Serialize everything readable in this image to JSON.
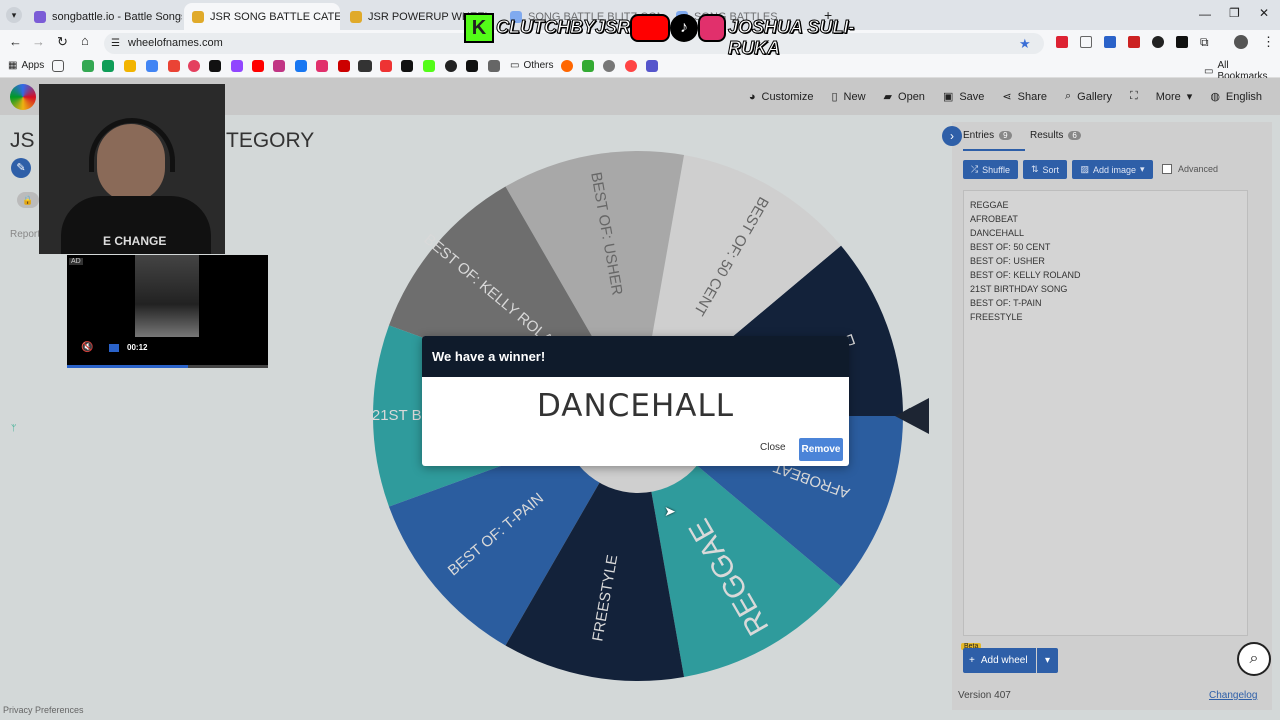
{
  "browser": {
    "tabs": [
      {
        "title": "songbattle.io - Battle Songs ag",
        "color": "#7b5cd6"
      },
      {
        "title": "JSR SONG BATTLE CATEGO",
        "color": "#e0aa2a"
      },
      {
        "title": "JSR POWERUP WHEEL",
        "color": "#e0aa2a"
      },
      {
        "title": "SONG BATTLE BLITZ COMP - E",
        "color": "#4285f4"
      },
      {
        "title": "SONG BATTLES",
        "color": "#4285f4"
      }
    ],
    "url": "wheelofnames.com",
    "bookmarks": {
      "apps": "Apps",
      "others": "Others",
      "all": "All Bookmarks"
    }
  },
  "overlay": {
    "brand_left": "CLUTCHBYJSR",
    "brand_right": "JOSHUA SULI-RUKA",
    "ad_badge": "AD",
    "ad_time": "00:12",
    "cam_text": "E CHANGE"
  },
  "nav": {
    "customize": "Customize",
    "new": "New",
    "open": "Open",
    "save": "Save",
    "share": "Share",
    "gallery": "Gallery",
    "more": "More",
    "language": "English"
  },
  "page": {
    "title_left": "JS",
    "title_right": "TEGORY",
    "report": "Report",
    "privacy": "Privacy Preferences"
  },
  "wheel": {
    "segments": [
      {
        "label": "REGGAE",
        "color": "#2f9b9c"
      },
      {
        "label": "AFROBEAT",
        "color": "#2b5d9f"
      },
      {
        "label": "DANCEHALL",
        "color": "#13223a"
      },
      {
        "label": "BEST OF: 50 CENT",
        "color": "#cfcfcf"
      },
      {
        "label": "BEST OF: USHER",
        "color": "#a8a8a8"
      },
      {
        "label": "BEST OF: KELLY ROLAND",
        "color": "#6e6e6e"
      },
      {
        "label": "21ST BIRTHDAY SONG",
        "color": "#2f9b9c"
      },
      {
        "label": "BEST OF: T-PAIN",
        "color": "#2b5d9f"
      },
      {
        "label": "FREESTYLE",
        "color": "#13223a"
      }
    ]
  },
  "modal": {
    "heading": "We have a winner!",
    "winner": "DANCEHALL",
    "close": "Close",
    "remove": "Remove"
  },
  "panel": {
    "entries_tab": "Entries",
    "entries_count": "9",
    "results_tab": "Results",
    "results_count": "6",
    "shuffle": "Shuffle",
    "sort": "Sort",
    "add_image": "Add image",
    "advanced": "Advanced",
    "entries": [
      "REGGAE",
      "AFROBEAT",
      "DANCEHALL",
      "BEST OF: 50 CENT",
      "BEST OF: USHER",
      "BEST OF: KELLY ROLAND",
      "21ST BIRTHDAY SONG",
      "BEST OF: T-PAIN",
      "FREESTYLE"
    ],
    "beta": "Beta",
    "add_wheel": "Add wheel",
    "version": "Version 407",
    "changelog": "Changelog"
  }
}
